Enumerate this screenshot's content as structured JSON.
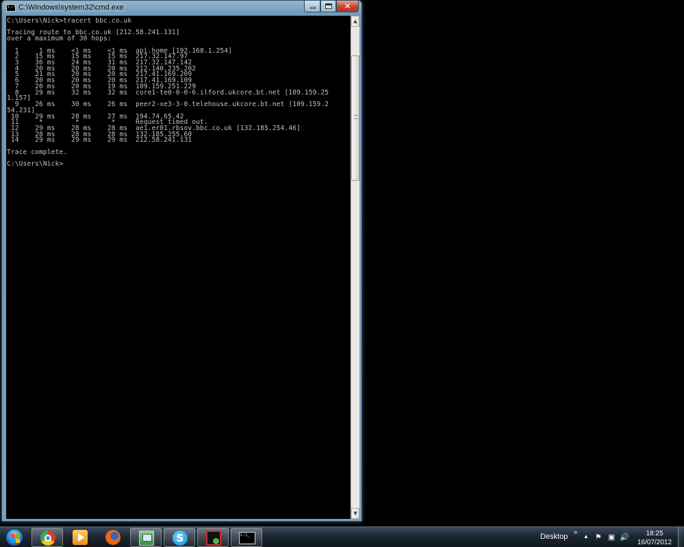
{
  "window": {
    "title": "C:\\Windows\\system32\\cmd.exe",
    "icon": "cmd-icon"
  },
  "console": {
    "lines": [
      "C:\\Users\\Nick>tracert bbc.co.uk",
      "",
      "Tracing route to bbc.co.uk [212.58.241.131]",
      "over a maximum of 30 hops:",
      "",
      "  1     1 ms    <1 ms    <1 ms  api.home [192.168.1.254]",
      "  2    15 ms    15 ms    15 ms  217.32.147.97",
      "  3    36 ms    24 ms    31 ms  217.32.147.142",
      "  4    20 ms    20 ms    20 ms  212.140.235.202",
      "  5    21 ms    20 ms    20 ms  217.41.169.209",
      "  6    20 ms    20 ms    20 ms  217.41.169.109",
      "  7    20 ms    20 ms    19 ms  109.159.251.229",
      "  8    29 ms    32 ms    32 ms  core1-te0-0-0-6.ilford.ukcore.bt.net [109.159.25",
      "1.157]",
      "  9    26 ms    30 ms    26 ms  peer2-xe3-3-0.telehouse.ukcore.bt.net [109.159.2",
      "54.231]",
      " 10    29 ms    28 ms    27 ms  194.74.65.42",
      " 11     *        *        *     Request timed out.",
      " 12    29 ms    28 ms    28 ms  ae1.er01.rbsov.bbc.co.uk [132.185.254.46]",
      " 13    28 ms    28 ms    28 ms  132.185.255.60",
      " 14    29 ms    29 ms    29 ms  212.58.241.131",
      "",
      "Trace complete.",
      "",
      "C:\\Users\\Nick>"
    ]
  },
  "scrollbar": {
    "up_glyph": "▲",
    "down_glyph": "▼"
  },
  "window_buttons": {
    "close_glyph": "✕"
  },
  "taskbar": {
    "apps": [
      {
        "name": "chrome",
        "icon": "chrome-icon"
      },
      {
        "name": "media-player",
        "icon": "media-player-icon"
      },
      {
        "name": "firefox",
        "icon": "firefox-icon"
      },
      {
        "name": "windows-explorer",
        "icon": "explorer-icon"
      },
      {
        "name": "skype",
        "icon": "skype-icon",
        "glyph": "S"
      },
      {
        "name": "packet-sniffer",
        "icon": "sniffer-icon"
      },
      {
        "name": "cmd",
        "icon": "cmd-icon",
        "glyph": "C:\\_"
      }
    ],
    "desktop_label": "Desktop",
    "chevron": "»",
    "tray_arrow": "▲",
    "tray_icons": {
      "flag": "⚑",
      "network": "▣",
      "volume": "🔊"
    },
    "clock": {
      "time": "18:25",
      "date": "16/07/2012"
    }
  },
  "colors": {
    "console_bg": "#000000",
    "console_fg": "#c0c0c0",
    "close_button": "#c7432a",
    "taskbar": "#1c2733"
  }
}
